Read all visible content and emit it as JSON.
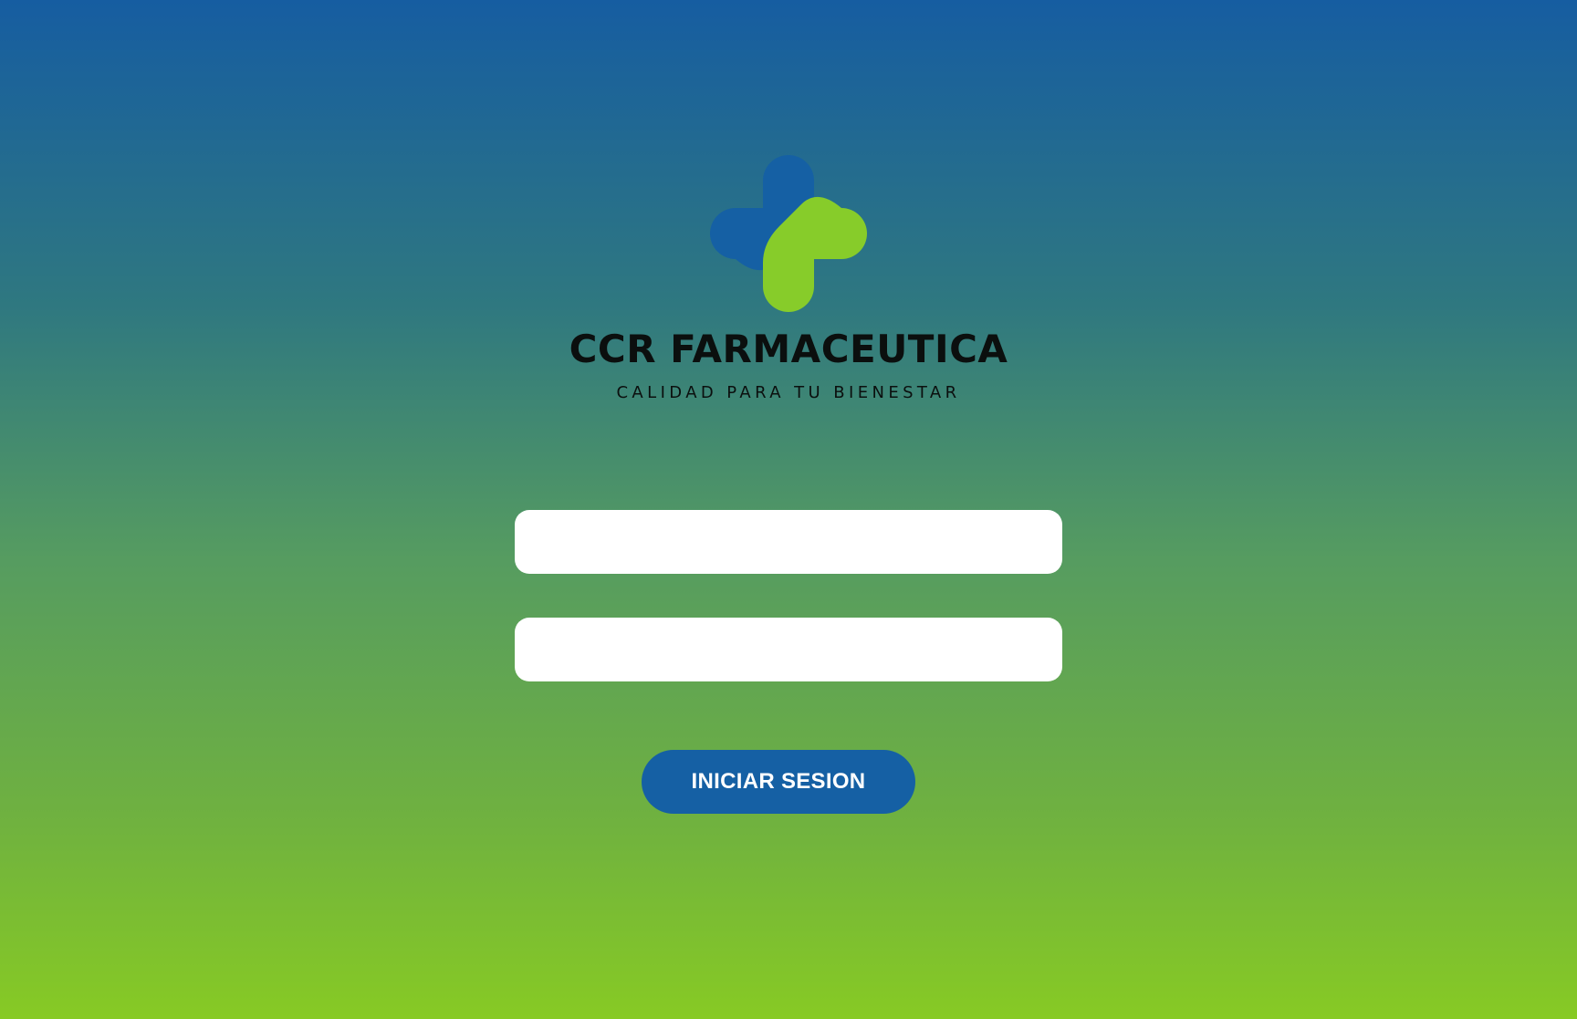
{
  "brand": {
    "name": "CCR FARMACEUTICA",
    "tagline": "CALIDAD PARA TU BIENESTAR",
    "logo_icon": "medical-cross-logo",
    "colors": {
      "primary_blue": "#1560a4",
      "accent_green": "#87cc2a",
      "gradient_top": "#165da1",
      "gradient_bottom": "#87ca24"
    }
  },
  "form": {
    "username": {
      "value": "",
      "placeholder": ""
    },
    "password": {
      "value": "",
      "placeholder": ""
    },
    "submit_label": "INICIAR SESION"
  }
}
